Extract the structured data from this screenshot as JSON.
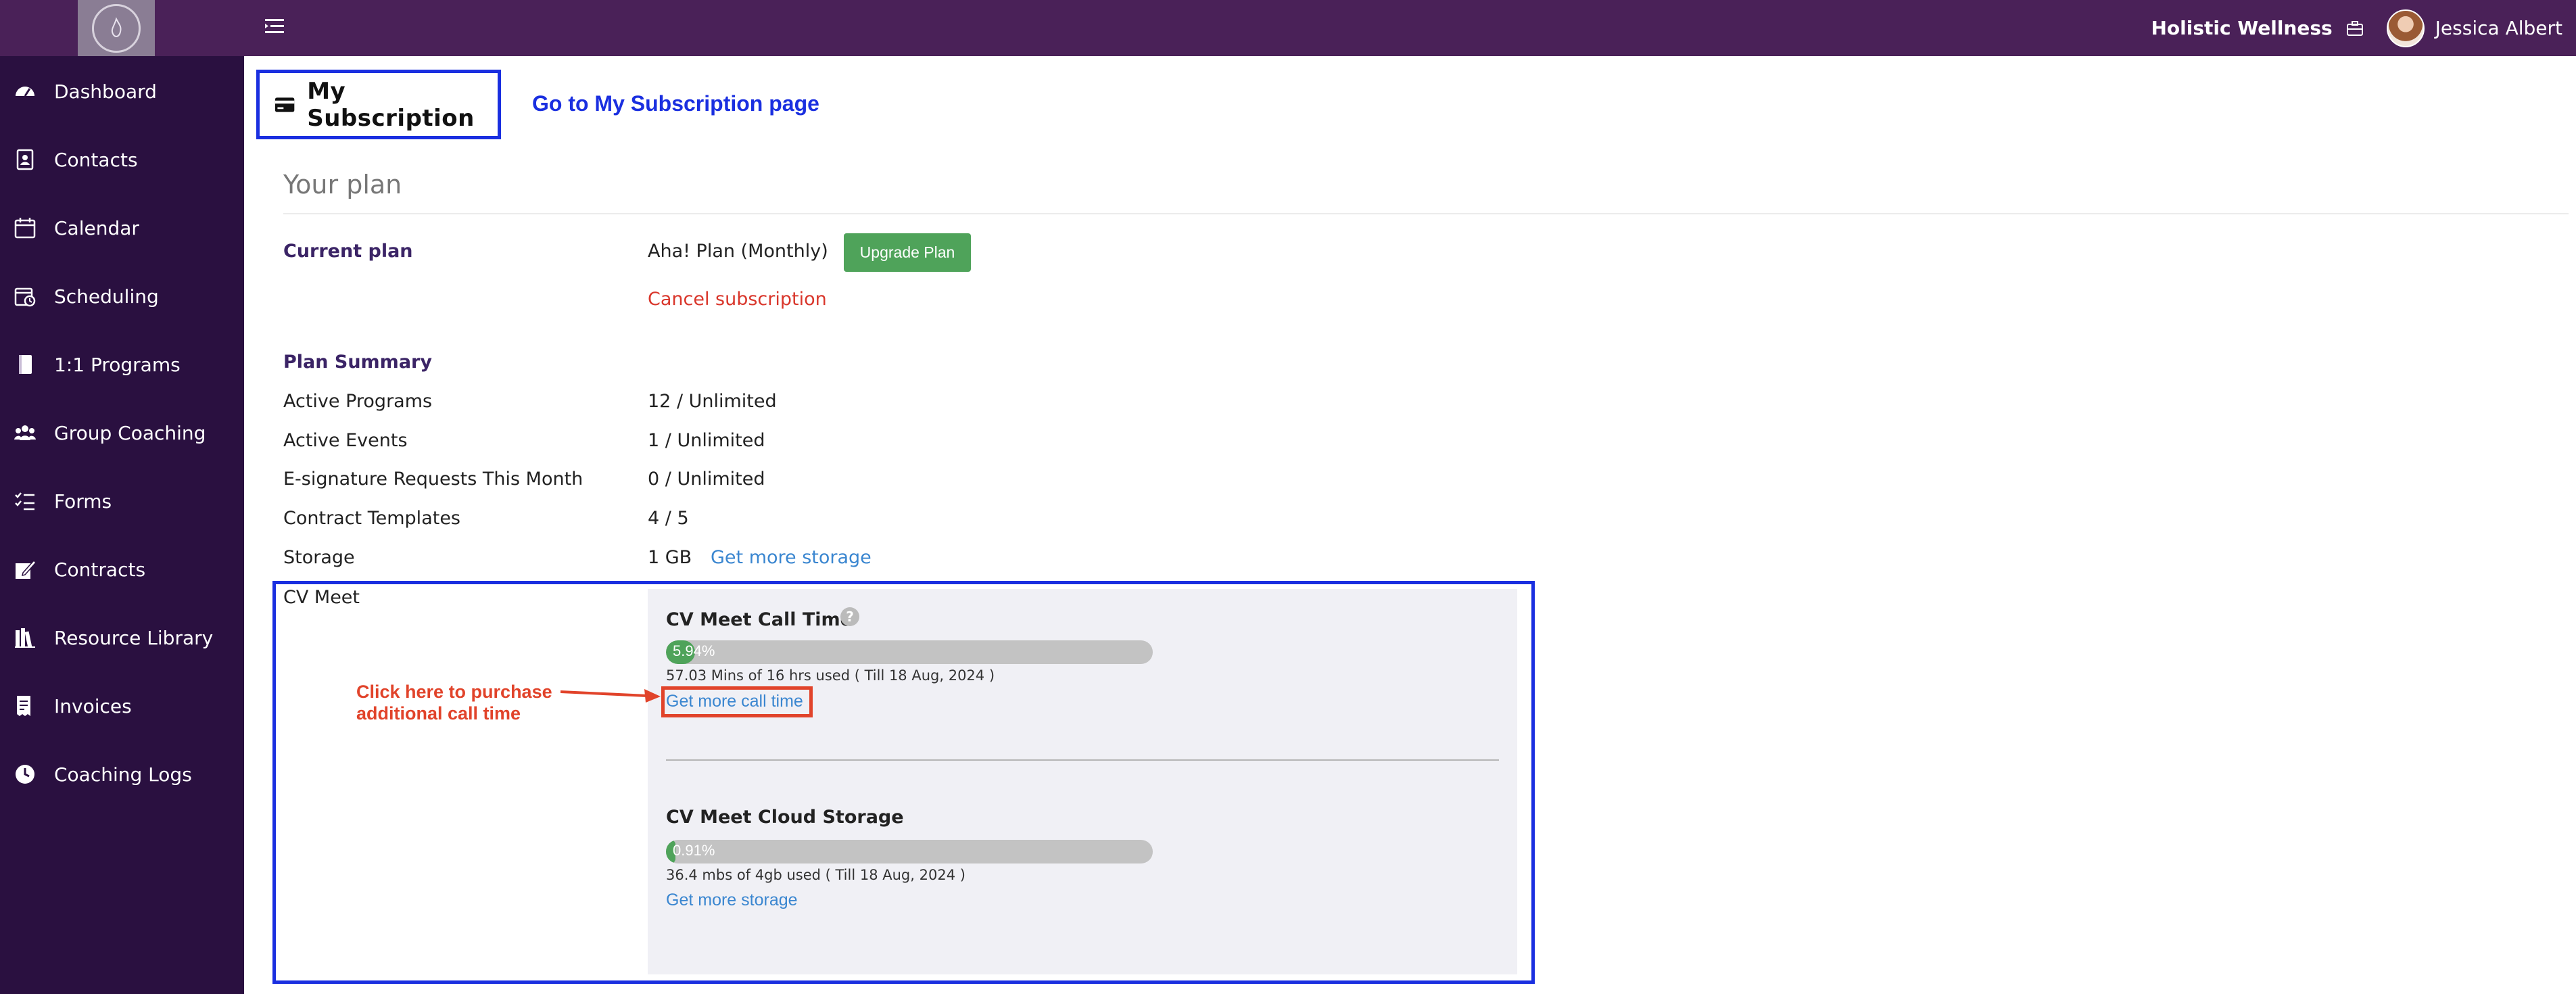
{
  "topbar": {
    "brand_name": "Holistic Wellness",
    "user_name": "Jessica Albert",
    "icons": [
      "menu-collapse-icon",
      "briefcase-icon",
      "avatar"
    ]
  },
  "sidebar": {
    "items": [
      {
        "label": "Dashboard",
        "icon": "speedometer-icon"
      },
      {
        "label": "Contacts",
        "icon": "contact-card-icon"
      },
      {
        "label": "Calendar",
        "icon": "calendar-icon"
      },
      {
        "label": "Scheduling",
        "icon": "calendar-clock-icon"
      },
      {
        "label": "1:1 Programs",
        "icon": "book-icon"
      },
      {
        "label": "Group Coaching",
        "icon": "users-icon"
      },
      {
        "label": "Forms",
        "icon": "checklist-icon"
      },
      {
        "label": "Contracts",
        "icon": "signature-icon"
      },
      {
        "label": "Resource Library",
        "icon": "library-icon"
      },
      {
        "label": "Invoices",
        "icon": "invoice-icon"
      },
      {
        "label": "Coaching Logs",
        "icon": "clock-icon"
      }
    ]
  },
  "header": {
    "title": "My Subscription",
    "goto_link": "Go to My Subscription page"
  },
  "plan": {
    "heading": "Your plan",
    "current_plan_label": "Current plan",
    "current_plan_value": "Aha! Plan (Monthly)",
    "upgrade_button": "Upgrade Plan",
    "cancel_link": "Cancel subscription"
  },
  "summary": {
    "heading": "Plan Summary",
    "rows": [
      {
        "label": "Active Programs",
        "value": "12 / Unlimited"
      },
      {
        "label": "Active Events",
        "value": "1 / Unlimited"
      },
      {
        "label": "E-signature Requests This Month",
        "value": "0 / Unlimited"
      },
      {
        "label": "Contract Templates",
        "value": "4 / 5"
      },
      {
        "label": "Storage",
        "value": "1 GB"
      }
    ],
    "storage_link": "Get more storage"
  },
  "cv_meet": {
    "label": "CV Meet",
    "call_time": {
      "title": "CV Meet Call Time",
      "percent_label": "5.94%",
      "percent": 5.94,
      "usage": "57.03 Mins of 16 hrs used  ( Till 18 Aug, 2024 )",
      "link": "Get more call time"
    },
    "cloud_storage": {
      "title": "CV Meet Cloud Storage",
      "percent_label": "0.91%",
      "percent": 0.91,
      "usage": "36.4 mbs of 4gb used  ( Till 18 Aug, 2024 )",
      "link": "Get more storage"
    }
  },
  "annotation": {
    "line1": "Click here to purchase",
    "line2": "additional call time"
  },
  "colors": {
    "topbar": "#4a2158",
    "sidebar": "#2a1040",
    "highlight_blue": "#1a2fe0",
    "annotation_red": "#e1432a",
    "progress_green": "#4fa35a",
    "link_blue": "#3a86d0"
  }
}
